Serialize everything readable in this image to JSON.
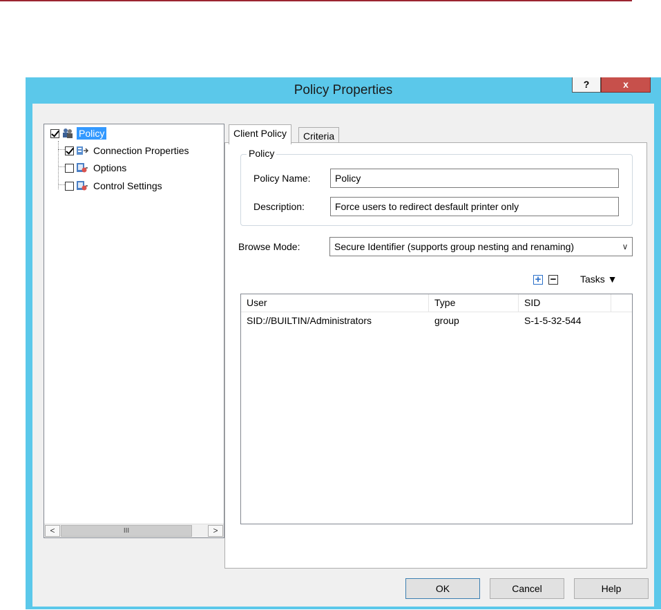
{
  "window": {
    "title": "Policy Properties",
    "help_label": "?",
    "close_label": "x"
  },
  "tree": {
    "items": [
      {
        "label": "Policy",
        "checked": true,
        "selected": true
      },
      {
        "label": "Connection Properties",
        "checked": true
      },
      {
        "label": "Options",
        "checked": false
      },
      {
        "label": "Control Settings",
        "checked": false
      }
    ],
    "scroll_left": "<",
    "scroll_thumb": "III",
    "scroll_right": ">"
  },
  "tabs": [
    {
      "label": "Client Policy"
    },
    {
      "label": "Criteria"
    }
  ],
  "policy_group": {
    "legend": "Policy",
    "name_label": "Policy Name:",
    "name_value": "Policy",
    "description_label": "Description:",
    "description_value": "Force users to redirect desfault printer only"
  },
  "browse": {
    "label": "Browse Mode:",
    "value": "Secure Identifier (supports group nesting and renaming)"
  },
  "toolbar": {
    "add_label": "+",
    "remove_label": "−",
    "tasks_label": "Tasks ▼"
  },
  "table": {
    "columns": [
      "User",
      "Type",
      "SID"
    ],
    "rows": [
      [
        "SID://BUILTIN/Administrators",
        "group",
        "S-1-5-32-544"
      ]
    ]
  },
  "buttons": {
    "ok": "OK",
    "cancel": "Cancel",
    "help": "Help"
  },
  "colors": {
    "frame": "#5bc8ea",
    "close": "#c7504b",
    "selection": "#3399ff"
  }
}
